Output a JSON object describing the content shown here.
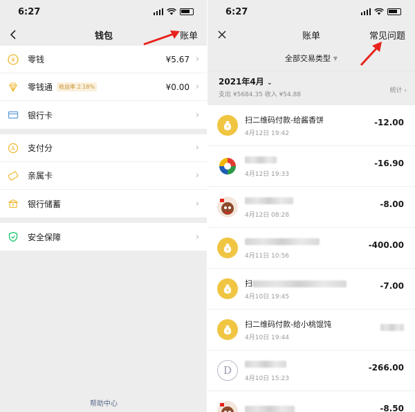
{
  "status": {
    "time": "6:27"
  },
  "wallet": {
    "title": "钱包",
    "bill_link": "账单",
    "items": [
      {
        "label": "零钱",
        "value": "¥5.67",
        "icon": "coin-icon",
        "color": "#f0b72f"
      },
      {
        "label": "零钱通",
        "value": "¥0.00",
        "tag": "收益率 2.18%",
        "icon": "diamond-icon",
        "color": "#f0b72f"
      },
      {
        "label": "银行卡",
        "icon": "card-icon",
        "color": "#5b9bd5"
      }
    ],
    "items2": [
      {
        "label": "支付分",
        "icon": "score-icon",
        "color": "#f0b72f"
      },
      {
        "label": "亲属卡",
        "icon": "family-card-icon",
        "color": "#f0b72f"
      },
      {
        "label": "银行储蓄",
        "icon": "savings-icon",
        "color": "#f0b72f"
      }
    ],
    "items3": [
      {
        "label": "安全保障",
        "icon": "shield-icon",
        "color": "#07c160"
      }
    ],
    "help": "帮助中心"
  },
  "bill": {
    "title": "账单",
    "faq": "常见问题",
    "filter": "全部交易类型",
    "month": "2021年4月",
    "summary": "支出 ¥5684.35 收入 ¥54.88",
    "stats": "统计",
    "transactions": [
      {
        "title": "扫二维码付款-给酱香饼",
        "time": "4月12日 19:42",
        "amount": "-12.00",
        "avatar": "coin"
      },
      {
        "title": "",
        "time": "4月12日 19:33",
        "amount": "-16.90",
        "avatar": "swirl"
      },
      {
        "title": "",
        "time": "4月12日 08:28",
        "amount": "-8.00",
        "avatar": "cartoon"
      },
      {
        "title": "",
        "time": "4月11日 10:56",
        "amount": "-400.00",
        "avatar": "coin"
      },
      {
        "title": "扫",
        "time": "4月10日 19:45",
        "amount": "-7.00",
        "avatar": "coin"
      },
      {
        "title": "扫二维码付款-给小桃馄饨",
        "time": "4月10日 19:44",
        "amount": "",
        "avatar": "coin"
      },
      {
        "title": "",
        "time": "4月10日 15:23",
        "amount": "-266.00",
        "avatar": "letter-d"
      },
      {
        "title": "",
        "time": "",
        "amount": "-8.50",
        "avatar": "cartoon"
      }
    ]
  },
  "colors": {
    "accent_red": "#e8231b",
    "coin": "#f0c542",
    "green": "#07c160"
  }
}
